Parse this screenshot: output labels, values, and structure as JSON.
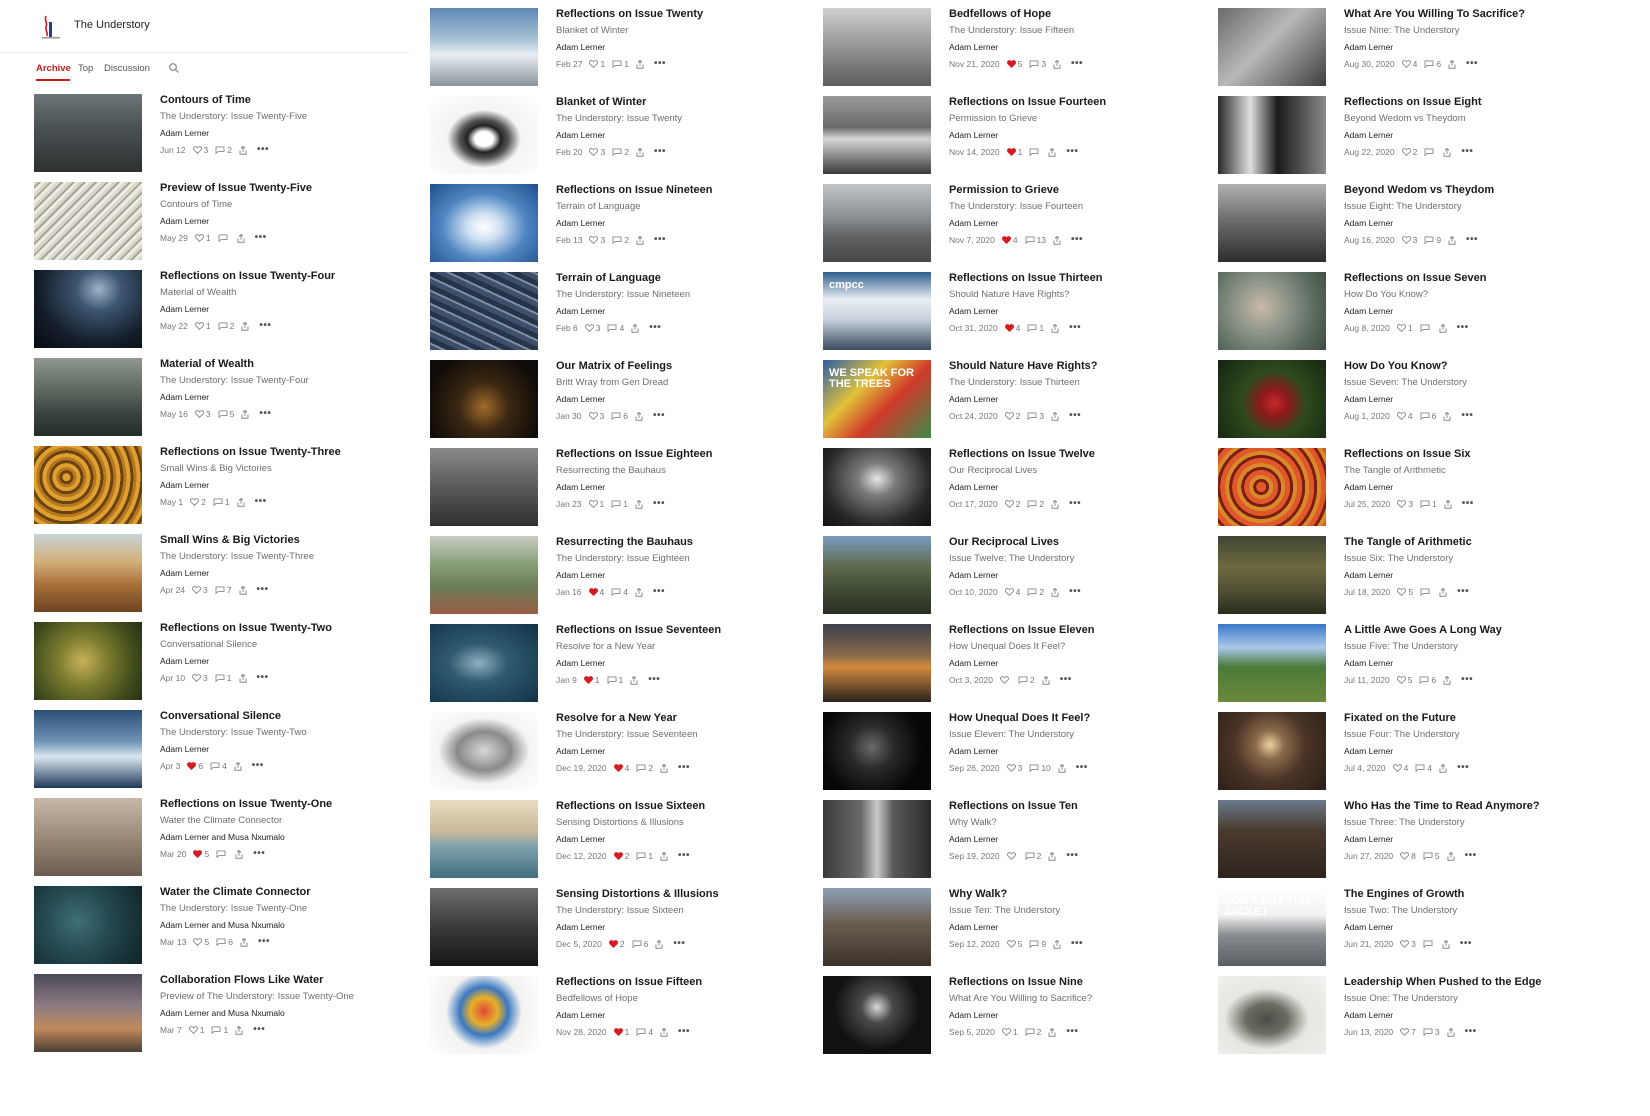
{
  "site": {
    "title": "The Understory",
    "logo_icon": "tree-logo-icon"
  },
  "tabs": [
    {
      "label": "Archive",
      "active": true
    },
    {
      "label": "Top",
      "active": false
    },
    {
      "label": "Discussion",
      "active": false
    }
  ],
  "colors": {
    "accent": "#c41e1e",
    "heart_liked": "#d71a21",
    "text_secondary": "#6f6f6f"
  },
  "columns": [
    [
      {
        "title": "Contours of Time",
        "subtitle": "The Understory: Issue Twenty-Five",
        "author": "Adam Lerner",
        "date": "Jun 12",
        "likes": "3",
        "liked": false,
        "comments": "2",
        "image_bg": "linear-gradient(180deg,#6c7678 0%,#4a5052 45%,#2d3031 100%)",
        "image_text": ""
      },
      {
        "title": "Preview of Issue Twenty-Five",
        "subtitle": "Contours of Time",
        "author": "Adam Lerner",
        "date": "May 29",
        "likes": "1",
        "liked": false,
        "comments": "",
        "image_bg": "repeating-linear-gradient(135deg,#d9d6cc 0 3px,#a7a399 3px 5px,#eeebe2 5px 8px)",
        "image_text": ""
      },
      {
        "title": "Reflections on Issue Twenty-Four",
        "subtitle": "Material of Wealth",
        "author": "Adam Lerner",
        "date": "May 22",
        "likes": "1",
        "liked": false,
        "comments": "2",
        "image_bg": "radial-gradient(ellipse at 60% 25%,#9eb3c8 0%,#3d5670 25%,#141d2a 65%,#070b12 100%)",
        "image_text": ""
      },
      {
        "title": "Material of Wealth",
        "subtitle": "The Understory: Issue Twenty-Four",
        "author": "Adam Lerner",
        "date": "May 16",
        "likes": "3",
        "liked": false,
        "comments": "5",
        "image_bg": "linear-gradient(180deg,#8e9790 0%,#5f6a62 40%,#3a4540 70%,#252d29 100%)",
        "image_text": ""
      },
      {
        "title": "Reflections on Issue Twenty-Three",
        "subtitle": "Small Wins & Big Victories",
        "author": "Adam Lerner",
        "date": "May 1",
        "likes": "2",
        "liked": false,
        "comments": "1",
        "image_bg": "repeating-radial-gradient(circle at 30% 40%,#e0a030 0 4px,#6b4210 4px 7px,#b5781e 7px 10px)",
        "image_text": ""
      },
      {
        "title": "Small Wins & Big Victories",
        "subtitle": "The Understory: Issue Twenty-Three",
        "author": "Adam Lerner",
        "date": "Apr 24",
        "likes": "3",
        "liked": false,
        "comments": "7",
        "image_bg": "linear-gradient(180deg,#c7d4d8 0%,#d3b07a 35%,#a86f3a 65%,#6d4321 100%)",
        "image_text": ""
      },
      {
        "title": "Reflections on Issue Twenty-Two",
        "subtitle": "Conversational Silence",
        "author": "Adam Lerner",
        "date": "Apr 10",
        "likes": "3",
        "liked": false,
        "comments": "1",
        "image_bg": "radial-gradient(circle at 45% 50%,#c9b25a 0%,#7b7c2e 35%,#3e4a1c 75%,#27301a 100%)",
        "image_text": ""
      },
      {
        "title": "Conversational Silence",
        "subtitle": "The Understory: Issue Twenty-Two",
        "author": "Adam Lerner",
        "date": "Apr 3",
        "likes": "6",
        "liked": true,
        "comments": "4",
        "image_bg": "linear-gradient(180deg,#2c4f77 0%,#6e93b5 40%,#d9e6ef 60%,#1e3a5a 100%)",
        "image_text": ""
      },
      {
        "title": "Reflections on Issue Twenty-One",
        "subtitle": "Water the Climate Connector",
        "author": "Adam Lerner and Musa Nxumalo",
        "date": "Mar 20",
        "likes": "5",
        "liked": true,
        "comments": "",
        "image_bg": "linear-gradient(180deg,#c7b8a8 0%,#9c8a78 50%,#6b5c4e 100%)",
        "image_text": ""
      },
      {
        "title": "Water the Climate Connector",
        "subtitle": "The Understory: Issue Twenty-One",
        "author": "Adam Lerner and Musa Nxumalo",
        "date": "Mar 13",
        "likes": "5",
        "liked": false,
        "comments": "6",
        "image_bg": "radial-gradient(circle at 40% 45%,#3e6f78 0%,#24474e 45%,#0f2226 100%)",
        "image_text": ""
      },
      {
        "title": "Collaboration Flows Like Water",
        "subtitle": "Preview of The Understory: Issue Twenty-One",
        "author": "Adam Lerner and Musa Nxumalo",
        "date": "Mar 7",
        "likes": "1",
        "liked": false,
        "comments": "1",
        "image_bg": "linear-gradient(180deg,#4b4a57 0%,#8b7b82 40%,#c08a5c 70%,#4d3d35 100%)",
        "image_text": ""
      }
    ],
    [
      {
        "title": "Reflections on Issue Twenty",
        "subtitle": "Blanket of Winter",
        "author": "Adam Lerner",
        "date": "Feb 27",
        "likes": "1",
        "liked": false,
        "comments": "1",
        "image_bg": "linear-gradient(180deg,#5d87b3 0%,#a8c1d6 40%,#e8eef2 60%,#8a939a 100%)",
        "image_text": ""
      },
      {
        "title": "Blanket of Winter",
        "subtitle": "The Understory: Issue Twenty",
        "author": "Adam Lerner",
        "date": "Feb 20",
        "likes": "3",
        "liked": false,
        "comments": "2",
        "image_bg": "radial-gradient(ellipse at 50% 55%,#ffffff 0%,#ffffff 12%,#222 22%,#555 32%,#f4f4f4 48%,#ffffff 100%)",
        "image_text": ""
      },
      {
        "title": "Reflections on Issue Nineteen",
        "subtitle": "Terrain of Language",
        "author": "Adam Lerner",
        "date": "Feb 13",
        "likes": "3",
        "liked": false,
        "comments": "2",
        "image_bg": "radial-gradient(ellipse at 50% 55%,#ffffff 0%,#cfe0f2 22%,#4f86c2 55%,#1f4f8e 100%)",
        "image_text": ""
      },
      {
        "title": "Terrain of Language",
        "subtitle": "The Understory: Issue Nineteen",
        "author": "Adam Lerner",
        "date": "Feb 6",
        "likes": "3",
        "liked": false,
        "comments": "4",
        "image_bg": "repeating-linear-gradient(25deg,#3d4f6b 0 5px,#7e8ea5 5px 7px,#263449 7px 12px)",
        "image_text": ""
      },
      {
        "title": "Our Matrix of Feelings",
        "subtitle": "Britt Wray from Gen Dread",
        "author": "Adam Lerner",
        "date": "Jan 30",
        "likes": "3",
        "liked": false,
        "comments": "6",
        "image_bg": "radial-gradient(circle at 50% 60%,#a06a2c 0%,#3b2712 35%,#0f0c09 80%)",
        "image_text": ""
      },
      {
        "title": "Reflections on Issue Eighteen",
        "subtitle": "Resurrecting the Bauhaus",
        "author": "Adam Lerner",
        "date": "Jan 23",
        "likes": "1",
        "liked": false,
        "comments": "1",
        "image_bg": "linear-gradient(180deg,#8a8a8a 0%,#5a5a5a 50%,#2f2f2f 100%)",
        "image_text": ""
      },
      {
        "title": "Resurrecting the Bauhaus",
        "subtitle": "The Understory: Issue Eighteen",
        "author": "Adam Lerner",
        "date": "Jan 16",
        "likes": "4",
        "liked": true,
        "comments": "4",
        "image_bg": "linear-gradient(180deg,#c9cdc4 0%,#8aa07a 35%,#6a7c57 65%,#9a5c45 100%)",
        "image_text": ""
      },
      {
        "title": "Reflections on Issue Seventeen",
        "subtitle": "Resolve for a New Year",
        "author": "Adam Lerner",
        "date": "Jan 9",
        "likes": "1",
        "liked": true,
        "comments": "1",
        "image_bg": "radial-gradient(ellipse at 45% 50%,#8fb0c0 0%,#2f5a70 35%,#123246 100%)",
        "image_text": ""
      },
      {
        "title": "Resolve for a New Year",
        "subtitle": "The Understory: Issue Seventeen",
        "author": "Adam Lerner",
        "date": "Dec 19, 2020",
        "likes": "4",
        "liked": true,
        "comments": "2",
        "image_bg": "radial-gradient(ellipse at 50% 50%,#d8d8d8 0%,#8a8a8a 35%,#f4f4f4 60%,#ffffff 100%)",
        "image_text": ""
      },
      {
        "title": "Reflections on Issue Sixteen",
        "subtitle": "Sensing Distortions & Illusions",
        "author": "Adam Lerner",
        "date": "Dec 12, 2020",
        "likes": "2",
        "liked": true,
        "comments": "1",
        "image_bg": "linear-gradient(180deg,#e9dcc2 0%,#c9b89a 40%,#7fa3ad 60%,#3f6e7e 100%)",
        "image_text": ""
      },
      {
        "title": "Sensing Distortions & Illusions",
        "subtitle": "The Understory: Issue Sixteen",
        "author": "Adam Lerner",
        "date": "Dec 5, 2020",
        "likes": "2",
        "liked": true,
        "comments": "6",
        "image_bg": "linear-gradient(180deg,#6e6e6e 0%,#3a3a3a 50%,#161616 100%)",
        "image_text": ""
      },
      {
        "title": "Reflections on Issue Fifteen",
        "subtitle": "Bedfellows of Hope",
        "author": "Adam Lerner",
        "date": "Nov 28, 2020",
        "likes": "1",
        "liked": true,
        "comments": "4",
        "image_bg": "radial-gradient(circle at 50% 45%,#e04a3a 0%,#e8b02a 20%,#3a78c0 35%,#f2f2f0 55%,#ffffff 100%)",
        "image_text": ""
      }
    ],
    [
      {
        "title": "Bedfellows of Hope",
        "subtitle": "The Understory: Issue Fifteen",
        "author": "Adam Lerner",
        "date": "Nov 21, 2020",
        "likes": "5",
        "liked": true,
        "comments": "3",
        "image_bg": "linear-gradient(180deg,#d0d0d0 0%,#9a9a9a 45%,#5c5c5c 100%)",
        "image_text": ""
      },
      {
        "title": "Reflections on Issue Fourteen",
        "subtitle": "Permission to Grieve",
        "author": "Adam Lerner",
        "date": "Nov 14, 2020",
        "likes": "1",
        "liked": true,
        "comments": "",
        "image_bg": "linear-gradient(180deg,#9a9a9a 0%,#6a6a6a 40%,#d6d6d6 55%,#3a3a3a 100%)",
        "image_text": ""
      },
      {
        "title": "Permission to Grieve",
        "subtitle": "The Understory: Issue Fourteen",
        "author": "Adam Lerner",
        "date": "Nov 7, 2020",
        "likes": "4",
        "liked": true,
        "comments": "13",
        "image_bg": "linear-gradient(180deg,#c0c4c6 0%,#8f9396 40%,#5d5f60 70%,#47484a 100%)",
        "image_text": ""
      },
      {
        "title": "Reflections on Issue Thirteen",
        "subtitle": "Should Nature Have Rights?",
        "author": "Adam Lerner",
        "date": "Oct 31, 2020",
        "likes": "4",
        "liked": true,
        "comments": "1",
        "image_bg": "linear-gradient(180deg,#2e5e8e 0%,#e9eef4 35%,#c9d3df 60%,#3a4a5e 100%)",
        "image_text": "cmpcc"
      },
      {
        "title": "Should Nature Have Rights?",
        "subtitle": "The Understory: Issue Thirteen",
        "author": "Adam Lerner",
        "date": "Oct 24, 2020",
        "likes": "2",
        "liked": false,
        "comments": "3",
        "image_bg": "linear-gradient(135deg,#2b5da8 0%,#e0c23a 35%,#d23a2a 60%,#3b8a4a 100%)",
        "image_text": "WE SPEAK FOR THE TREES"
      },
      {
        "title": "Reflections on Issue Twelve",
        "subtitle": "Our Reciprocal Lives",
        "author": "Adam Lerner",
        "date": "Oct 17, 2020",
        "likes": "2",
        "liked": false,
        "comments": "2",
        "image_bg": "radial-gradient(ellipse at 50% 40%,#e6e6e6 0%,#7a7a7a 25%,#262626 70%,#111111 100%)",
        "image_text": ""
      },
      {
        "title": "Our Reciprocal Lives",
        "subtitle": "Issue Twelve: The Understory",
        "author": "Adam Lerner",
        "date": "Oct 10, 2020",
        "likes": "4",
        "liked": false,
        "comments": "2",
        "image_bg": "linear-gradient(180deg,#7a9bc0 0%,#5d6a4a 40%,#3f4a34 70%,#2a2f24 100%)",
        "image_text": ""
      },
      {
        "title": "Reflections on Issue Eleven",
        "subtitle": "How Unequal Does It Feel?",
        "author": "Adam Lerner",
        "date": "Oct 3, 2020",
        "likes": "",
        "liked": false,
        "comments": "2",
        "image_bg": "linear-gradient(180deg,#3d3f4c 0%,#8a6a4c 40%,#d28a3c 55%,#2a241e 100%)",
        "image_text": ""
      },
      {
        "title": "How Unequal Does It Feel?",
        "subtitle": "Issue Eleven: The Understory",
        "author": "Adam Lerner",
        "date": "Sep 26, 2020",
        "likes": "3",
        "liked": false,
        "comments": "10",
        "image_bg": "radial-gradient(circle at 45% 45%,#6a6a6a 0%,#2a2a2a 30%,#060606 70%)",
        "image_text": ""
      },
      {
        "title": "Reflections on Issue Ten",
        "subtitle": "Why Walk?",
        "author": "Adam Lerner",
        "date": "Sep 19, 2020",
        "likes": "",
        "liked": false,
        "comments": "2",
        "image_bg": "linear-gradient(90deg,#3a3a3a 0%,#6a6a6a 35%,#c8c8c8 50%,#5a5a5a 65%,#2a2a2a 100%)",
        "image_text": ""
      },
      {
        "title": "Why Walk?",
        "subtitle": "Issue Ten: The Understory",
        "author": "Adam Lerner",
        "date": "Sep 12, 2020",
        "likes": "5",
        "liked": false,
        "comments": "9",
        "image_bg": "linear-gradient(180deg,#8da0b5 0%,#6a5e52 45%,#3c322a 100%)",
        "image_text": ""
      },
      {
        "title": "Reflections on Issue Nine",
        "subtitle": "What Are You Willing to Sacrifice?",
        "author": "Adam Lerner",
        "date": "Sep 5, 2020",
        "likes": "1",
        "liked": false,
        "comments": "2",
        "image_bg": "radial-gradient(circle at 50% 40%,#d8d8d8 0%,#4a4a4a 22%,#111111 60%)",
        "image_text": ""
      }
    ],
    [
      {
        "title": "What Are You Willing To Sacrifice?",
        "subtitle": "Issue Nine: The Understory",
        "author": "Adam Lerner",
        "date": "Aug 30, 2020",
        "likes": "4",
        "liked": false,
        "comments": "6",
        "image_bg": "linear-gradient(135deg,#6a6a6a 0%,#b8b8b8 45%,#3e3e3e 100%)",
        "image_text": ""
      },
      {
        "title": "Reflections on Issue Eight",
        "subtitle": "Beyond Wedom vs Theydom",
        "author": "Adam Lerner",
        "date": "Aug 22, 2020",
        "likes": "2",
        "liked": false,
        "comments": "",
        "image_bg": "linear-gradient(90deg,#2a2a2a 0%,#dedede 30%,#1a1a1a 55%,#8a8a8a 100%)",
        "image_text": ""
      },
      {
        "title": "Beyond Wedom vs Theydom",
        "subtitle": "Issue Eight: The Understory",
        "author": "Adam Lerner",
        "date": "Aug 16, 2020",
        "likes": "3",
        "liked": false,
        "comments": "9",
        "image_bg": "linear-gradient(180deg,#b0b0b0 0%,#6e6e6e 45%,#2e2e2e 100%)",
        "image_text": ""
      },
      {
        "title": "Reflections on Issue Seven",
        "subtitle": "How Do You Know?",
        "author": "Adam Lerner",
        "date": "Aug 8, 2020",
        "likes": "1",
        "liked": false,
        "comments": "",
        "image_bg": "radial-gradient(circle at 40% 45%,#c9b9a8 0%,#8c9488 35%,#5a6a5e 70%,#3e4a42 100%)",
        "image_text": ""
      },
      {
        "title": "How Do You Know?",
        "subtitle": "Issue Seven: The Understory",
        "author": "Adam Lerner",
        "date": "Aug 1, 2020",
        "likes": "4",
        "liked": false,
        "comments": "6",
        "image_bg": "radial-gradient(circle at 52% 55%,#c8282a 0%,#8c1a1a 20%,#2e4a1e 45%,#142410 100%)",
        "image_text": ""
      },
      {
        "title": "Reflections on Issue Six",
        "subtitle": "The Tangle of Arithmetic",
        "author": "Adam Lerner",
        "date": "Jul 25, 2020",
        "likes": "3",
        "liked": false,
        "comments": "1",
        "image_bg": "repeating-radial-gradient(circle at 40% 50%,#e0582a 0 5px,#7a1e14 5px 8px,#d88a2a 8px 12px)",
        "image_text": ""
      },
      {
        "title": "The Tangle of Arithmetic",
        "subtitle": "Issue Six: The Understory",
        "author": "Adam Lerner",
        "date": "Jul 18, 2020",
        "likes": "5",
        "liked": false,
        "comments": "",
        "image_bg": "linear-gradient(180deg,#3e4632 0%,#6e6a3e 40%,#4a4a30 75%,#2a2c1e 100%)",
        "image_text": ""
      },
      {
        "title": "A Little Awe Goes A Long Way",
        "subtitle": "Issue Five: The Understory",
        "author": "Adam Lerner",
        "date": "Jul 11, 2020",
        "likes": "5",
        "liked": false,
        "comments": "6",
        "image_bg": "linear-gradient(180deg,#3a78c8 0%,#a8c8e8 30%,#4a7a3a 55%,#6a8a3a 100%)",
        "image_text": ""
      },
      {
        "title": "Fixated on the Future",
        "subtitle": "Issue Four: The Understory",
        "author": "Adam Lerner",
        "date": "Jul 4, 2020",
        "likes": "4",
        "liked": false,
        "comments": "4",
        "image_bg": "radial-gradient(circle at 48% 42%,#f0d0a0 0%,#8a6a4a 20%,#4a3426 50%,#2a1e16 100%)",
        "image_text": ""
      },
      {
        "title": "Who Has the Time to Read Anymore?",
        "subtitle": "Issue Three: The Understory",
        "author": "Adam Lerner",
        "date": "Jun 27, 2020",
        "likes": "8",
        "liked": false,
        "comments": "5",
        "image_bg": "linear-gradient(180deg,#6a7a8a 0%,#4a3a2e 40%,#2e241e 100%)",
        "image_text": ""
      },
      {
        "title": "The Engines of Growth",
        "subtitle": "Issue Two: The Understory",
        "author": "Adam Lerner",
        "date": "Jun 21, 2020",
        "likes": "3",
        "liked": false,
        "comments": "",
        "image_bg": "linear-gradient(180deg,#ffffff 0%,#f2f2f2 35%,#8a8e92 60%,#5a5e62 100%)",
        "image_text": "DON'T BUY THIS JACKET"
      },
      {
        "title": "Leadership When Pushed to the Edge",
        "subtitle": "Issue One: The Understory",
        "author": "Adam Lerner",
        "date": "Jun 13, 2020",
        "likes": "7",
        "liked": false,
        "comments": "3",
        "image_bg": "radial-gradient(ellipse at 45% 55%,#4a4e46 0%,#6a6e62 25%,#e6e6e2 50%,#f2f2f0 100%)",
        "image_text": ""
      }
    ]
  ]
}
